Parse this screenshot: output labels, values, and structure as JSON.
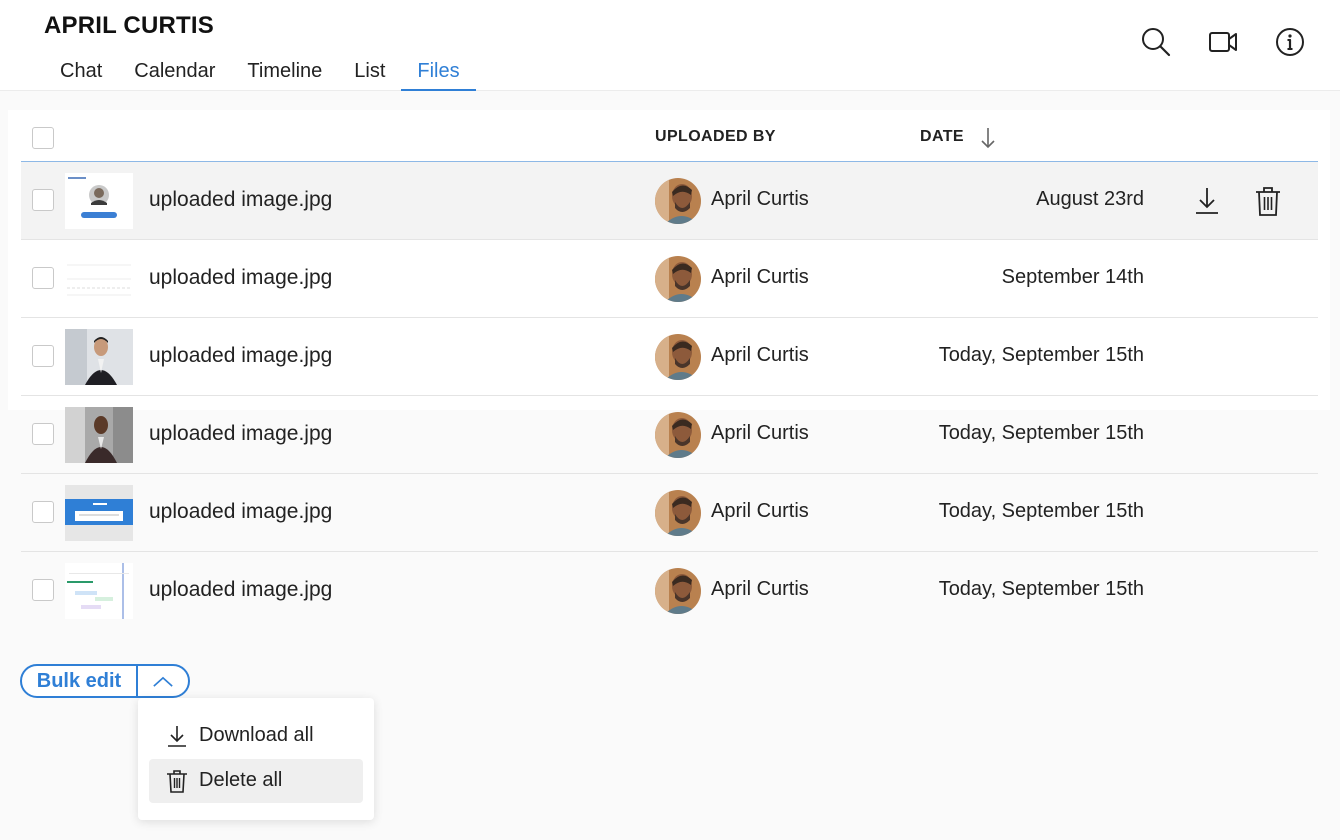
{
  "header": {
    "title": "APRIL CURTIS",
    "tabs": [
      {
        "label": "Chat",
        "active": false
      },
      {
        "label": "Calendar",
        "active": false
      },
      {
        "label": "Timeline",
        "active": false
      },
      {
        "label": "List",
        "active": false
      },
      {
        "label": "Files",
        "active": true
      }
    ],
    "icons": [
      "search-icon",
      "video-icon",
      "info-icon"
    ]
  },
  "table": {
    "columns": {
      "uploaded_by": "UPLOADED BY",
      "date": "DATE"
    },
    "sort": "date-descending",
    "rows": [
      {
        "file": "uploaded image.jpg",
        "uploader": "April Curtis",
        "date": "August 23rd",
        "hover": true
      },
      {
        "file": "uploaded image.jpg",
        "uploader": "April Curtis",
        "date": "September 14th",
        "hover": false
      },
      {
        "file": "uploaded image.jpg",
        "uploader": "April Curtis",
        "date": "Today, September 15th",
        "hover": false
      },
      {
        "file": "uploaded image.jpg",
        "uploader": "April Curtis",
        "date": "Today, September 15th",
        "hover": false
      },
      {
        "file": "uploaded image.jpg",
        "uploader": "April Curtis",
        "date": "Today, September 15th",
        "hover": false
      },
      {
        "file": "uploaded image.jpg",
        "uploader": "April Curtis",
        "date": "Today, September 15th",
        "hover": false
      }
    ]
  },
  "bulk_edit": {
    "label": "Bulk edit",
    "menu": [
      {
        "label": "Download all",
        "icon": "download-icon",
        "selected": false
      },
      {
        "label": "Delete all",
        "icon": "trash-icon",
        "selected": true
      }
    ]
  },
  "colors": {
    "accent": "#2f7fd6",
    "hover_row": "#f3f3f3"
  }
}
